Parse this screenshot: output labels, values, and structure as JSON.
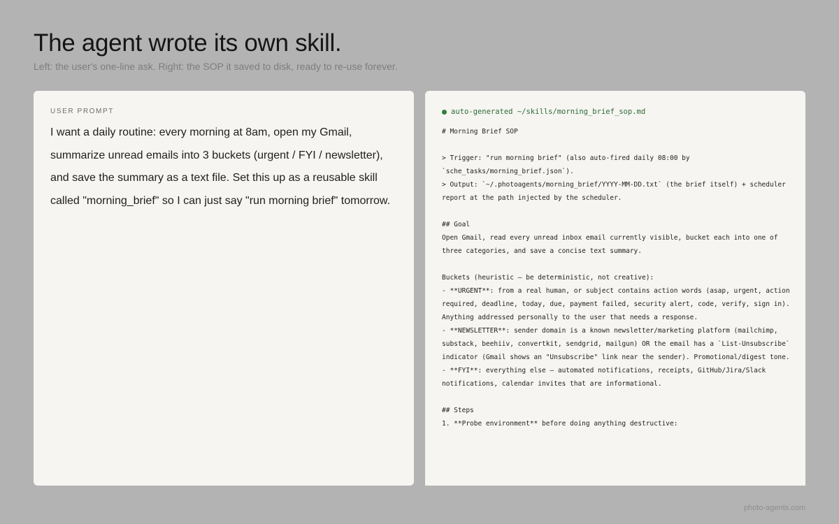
{
  "header": {
    "title": "The agent wrote its own skill.",
    "subtitle": "Left: the user's one-line ask.  Right: the SOP it saved to disk, ready to re-use forever."
  },
  "left_panel": {
    "label": "USER PROMPT",
    "prompt": "I want a daily routine: every morning at 8am, open my Gmail, summarize unread emails into 3 buckets (urgent / FYI / newsletter), and save the summary as a text file. Set this up as a reusable skill called \"morning_brief\" so I can just say \"run morning brief\" tomorrow."
  },
  "right_panel": {
    "status_label": "auto-generated",
    "file_path": "~/skills/morning_brief_sop.md",
    "status_color": "#2f7d3c",
    "lines": [
      "# Morning Brief SOP",
      "",
      "> Trigger: \"run morning brief\" (also auto-fired daily 08:00 by `sche_tasks/morning_brief.json`).",
      "> Output: `~/.photoagents/morning_brief/YYYY-MM-DD.txt` (the brief itself) + scheduler report at the path injected by the scheduler.",
      "",
      "## Goal",
      "Open Gmail, read every unread inbox email currently visible, bucket each into one of three categories, and save a concise text summary.",
      "",
      "Buckets (heuristic — be deterministic, not creative):",
      "- **URGENT**: from a real human, or subject contains action words (asap, urgent, action required, deadline, today, due, payment failed, security alert, code, verify, sign in). Anything addressed personally to the user that needs a response.",
      "- **NEWSLETTER**: sender domain is a known newsletter/marketing platform (mailchimp, substack, beehiiv, convertkit, sendgrid, mailgun) OR the email has a `List-Unsubscribe` indicator (Gmail shows an \"Unsubscribe\" link near the sender). Promotional/digest tone.",
      "- **FYI**: everything else — automated notifications, receipts, GitHub/Jira/Slack notifications, calendar invites that are informational.",
      "",
      "## Steps",
      "1. **Probe environment** before doing anything destructive:"
    ]
  },
  "footer": {
    "site": "photo-agents.com"
  }
}
